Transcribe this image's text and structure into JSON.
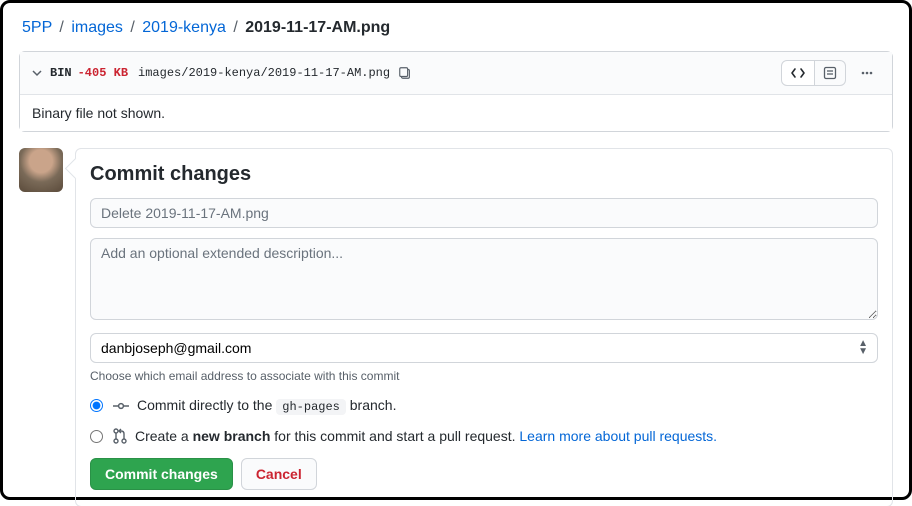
{
  "breadcrumb": {
    "parts": [
      "5PP",
      "images",
      "2019-kenya"
    ],
    "current": "2019-11-17-AM.png"
  },
  "file": {
    "bin_label": "BIN",
    "size_delta": "-405 KB",
    "path": "images/2019-kenya/2019-11-17-AM.png",
    "body_text": "Binary file not shown."
  },
  "commit": {
    "heading": "Commit changes",
    "summary_placeholder": "Delete 2019-11-17-AM.png",
    "description_placeholder": "Add an optional extended description...",
    "email_options": [
      "danbjoseph@gmail.com"
    ],
    "email_selected": "danbjoseph@gmail.com",
    "email_help": "Choose which email address to associate with this commit",
    "radio_direct_prefix": "Commit directly to the ",
    "radio_direct_branch": "gh-pages",
    "radio_direct_suffix": " branch.",
    "radio_branch_prefix": "Create a ",
    "radio_branch_bold": "new branch",
    "radio_branch_suffix": " for this commit and start a pull request. ",
    "learn_more": "Learn more about pull requests.",
    "submit_label": "Commit changes",
    "cancel_label": "Cancel"
  }
}
